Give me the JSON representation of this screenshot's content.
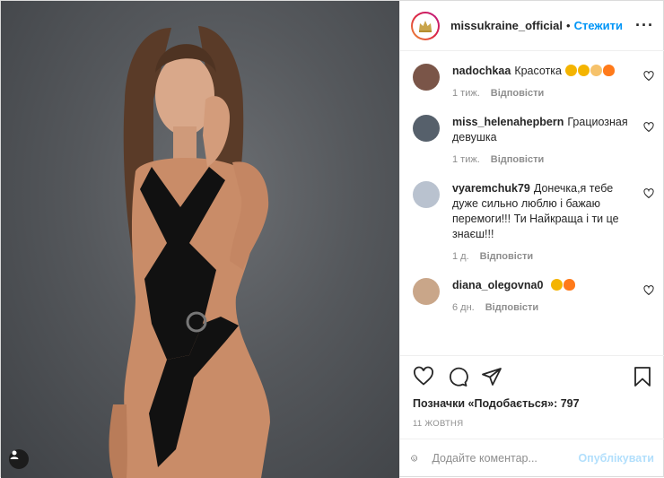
{
  "post": {
    "username": "missukraine_official",
    "separator": "•",
    "follow_label": "Стежити",
    "more_label": "···"
  },
  "comments": [
    {
      "user": "nadochkaa",
      "text": "Красотка",
      "emojis": [
        "heart-eyes-emoji",
        "heart-eyes-emoji",
        "clap-emoji",
        "fire-emoji"
      ],
      "time": "1 тиж.",
      "reply": "Відповісти",
      "avatar_color": "#7a5548"
    },
    {
      "user": "miss_helenahepbern",
      "text": "Грациозная девушка",
      "emojis": [],
      "time": "1 тиж.",
      "reply": "Відповісти",
      "avatar_color": "#56606b"
    },
    {
      "user": "vyaremchuk79",
      "text": "Донечка,я тебе дуже сильно люблю і бажаю перемоги!!! Ти Найкраща і ти це знаєш!!!",
      "emojis": [],
      "time": "1 д.",
      "reply": "Відповісти",
      "avatar_color": "#b9c2cf"
    },
    {
      "user": "diana_olegovna0",
      "text": "",
      "emojis": [
        "heart-eyes-emoji",
        "fire-emoji"
      ],
      "time": "6 дн.",
      "reply": "Відповісти",
      "avatar_color": "#c9a689"
    }
  ],
  "actions": {
    "like_icon": "heart-icon",
    "comment_icon": "comment-icon",
    "share_icon": "share-icon",
    "save_icon": "bookmark-icon"
  },
  "likes_text": "Позначки «Подобається»: 797",
  "date_text": "11 жовтня",
  "add_comment": {
    "placeholder": "Додайте коментар...",
    "publish_label": "Опублікувати"
  },
  "colors": {
    "accent": "#0095f6",
    "publish_disabled": "#b2dffc",
    "meta_gray": "#8e8e8e",
    "photo_bg": "#55585c"
  }
}
